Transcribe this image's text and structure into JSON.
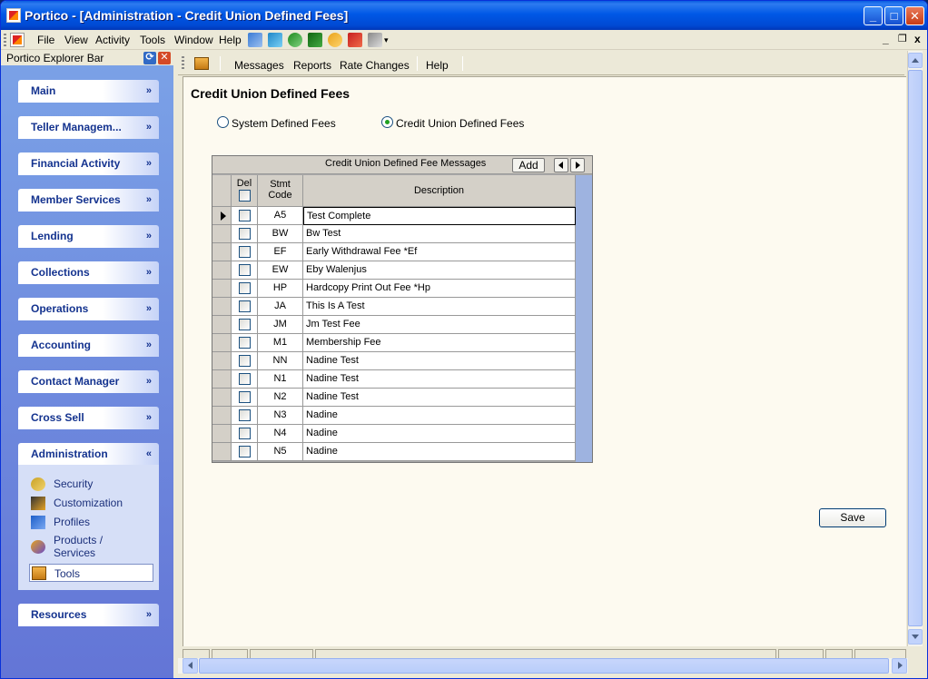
{
  "window": {
    "title": "Portico - [Administration - Credit Union Defined Fees]"
  },
  "menubar": {
    "items": [
      "File",
      "View",
      "Activity",
      "Tools",
      "Window",
      "Help"
    ],
    "mdi_min": "_",
    "mdi_restore": "❐",
    "mdi_close": "x"
  },
  "explorer": {
    "title": "Portico Explorer Bar",
    "groups": [
      {
        "label": "Main",
        "chevron": "»"
      },
      {
        "label": "Teller Managem...",
        "chevron": "»"
      },
      {
        "label": "Financial Activity",
        "chevron": "»"
      },
      {
        "label": "Member Services",
        "chevron": "»"
      },
      {
        "label": "Lending",
        "chevron": "»"
      },
      {
        "label": "Collections",
        "chevron": "»"
      },
      {
        "label": "Operations",
        "chevron": "»"
      },
      {
        "label": "Accounting",
        "chevron": "»"
      },
      {
        "label": "Contact Manager",
        "chevron": "»"
      },
      {
        "label": "Cross Sell",
        "chevron": "»"
      },
      {
        "label": "Administration",
        "chevron": "«"
      },
      {
        "label": "Resources",
        "chevron": "»"
      }
    ],
    "admin_items": [
      {
        "label": "Security",
        "icon": "keys-icon"
      },
      {
        "label": "Customization",
        "icon": "wrench-icon"
      },
      {
        "label": "Profiles",
        "icon": "profile-icon"
      },
      {
        "label": "Products / Services",
        "icon": "products-icon"
      },
      {
        "label": "Tools",
        "icon": "toolbox-icon",
        "selected": true
      }
    ]
  },
  "subtoolbar": {
    "items": [
      "Messages",
      "Reports",
      "Rate Changes",
      "Help"
    ]
  },
  "page": {
    "title": "Credit Union Defined Fees",
    "radio_system": "System Defined Fees",
    "radio_cu": "Credit Union Defined Fees",
    "selected_radio": "cu",
    "save_label": "Save"
  },
  "grid": {
    "caption": "Credit Union Defined Fee Messages",
    "add_label": "Add",
    "headers": {
      "del": "Del",
      "code": "Stmt Code",
      "desc": "Description"
    },
    "rows": [
      {
        "code": "A5",
        "desc": "Test Complete"
      },
      {
        "code": "BW",
        "desc": "Bw Test"
      },
      {
        "code": "EF",
        "desc": "Early Withdrawal Fee *Ef"
      },
      {
        "code": "EW",
        "desc": "Eby Walenjus"
      },
      {
        "code": "HP",
        "desc": "Hardcopy Print Out Fee *Hp"
      },
      {
        "code": "JA",
        "desc": "This Is A Test"
      },
      {
        "code": "JM",
        "desc": "Jm Test Fee"
      },
      {
        "code": "M1",
        "desc": "Membership Fee"
      },
      {
        "code": "NN",
        "desc": "Nadine Test"
      },
      {
        "code": "N1",
        "desc": "Nadine Test"
      },
      {
        "code": "N2",
        "desc": "Nadine Test"
      },
      {
        "code": "N3",
        "desc": "Nadine"
      },
      {
        "code": "N4",
        "desc": "Nadine"
      },
      {
        "code": "N5",
        "desc": "Nadine"
      }
    ]
  }
}
